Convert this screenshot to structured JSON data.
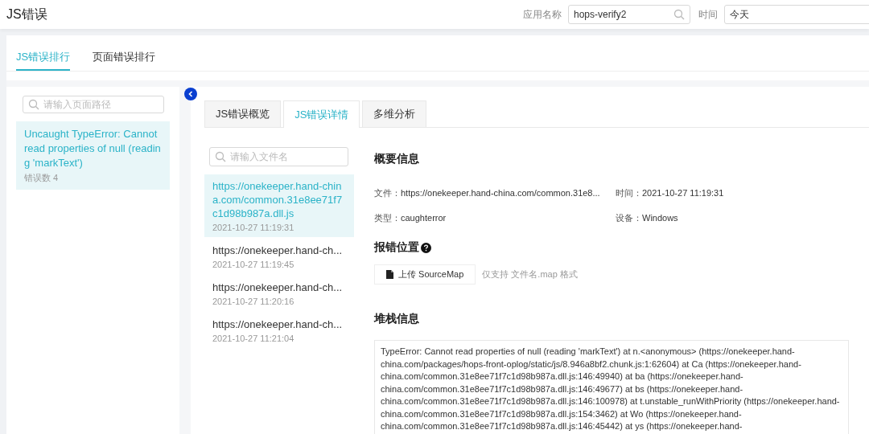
{
  "header": {
    "title": "JS错误",
    "app_label": "应用名称",
    "app_value": "hops-verify2",
    "time_label": "时间",
    "time_value": "今天"
  },
  "main_tabs": [
    {
      "label": "JS错误排行",
      "selected": true
    },
    {
      "label": "页面错误排行",
      "selected": false
    }
  ],
  "page_search": {
    "placeholder": "请输入页面路径"
  },
  "errors": [
    {
      "message": "Uncaught TypeError: Cannot read properties of null (reading 'markText')",
      "count": "错误数 4",
      "selected": true
    }
  ],
  "detail_tabs": [
    {
      "label": "JS错误概览",
      "selected": false
    },
    {
      "label": "JS错误详情",
      "selected": true
    },
    {
      "label": "多维分析",
      "selected": false
    }
  ],
  "file_search": {
    "placeholder": "请输入文件名"
  },
  "files": [
    {
      "url": "https://onekeeper.hand-china.com/common.31e8ee71f7c1d98b987a.dll.js",
      "time": "2021-10-27 11:19:31",
      "selected": true
    },
    {
      "url": "https://onekeeper.hand-ch...",
      "time": "2021-10-27 11:19:45",
      "selected": false
    },
    {
      "url": "https://onekeeper.hand-ch...",
      "time": "2021-10-27 11:20:16",
      "selected": false
    },
    {
      "url": "https://onekeeper.hand-ch...",
      "time": "2021-10-27 11:21:04",
      "selected": false
    }
  ],
  "summary": {
    "title": "概要信息",
    "fields": [
      {
        "label": "文件：",
        "value": "https://onekeeper.hand-china.com/common.31e8..."
      },
      {
        "label": "时间：",
        "value": "2021-10-27 11:19:31"
      },
      {
        "label": "类型：",
        "value": "caughterror"
      },
      {
        "label": "设备：",
        "value": "Windows"
      }
    ]
  },
  "location": {
    "title": "报错位置",
    "upload_button": "上传 SourceMap",
    "hint": "仅支持 文件名.map 格式"
  },
  "stack": {
    "title": "堆栈信息",
    "text": "TypeError: Cannot read properties of null (reading 'markText') at n.<anonymous> (https://onekeeper.hand-china.com/packages/hops-front-oplog/static/js/8.946a8bf2.chunk.js:1:62604) at Ca (https://onekeeper.hand-china.com/common.31e8ee71f7c1d98b987a.dll.js:146:49940) at ba (https://onekeeper.hand-china.com/common.31e8ee71f7c1d98b987a.dll.js:146:49677) at bs (https://onekeeper.hand-china.com/common.31e8ee71f7c1d98b987a.dll.js:146:100978) at t.unstable_runWithPriority (https://onekeeper.hand-china.com/common.31e8ee71f7c1d98b987a.dll.js:154:3462) at Wo (https://onekeeper.hand-china.com/common.31e8ee71f7c1d98b987a.dll.js:146:45442) at ys (https://onekeeper.hand-"
  }
}
